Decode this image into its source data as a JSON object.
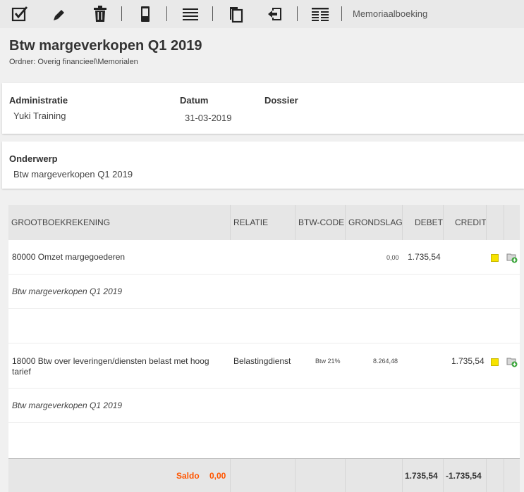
{
  "toolbar": {
    "buttons": [
      {
        "name": "approve",
        "icon": "checkbox-check-icon"
      },
      {
        "name": "edit",
        "icon": "pencil-icon"
      },
      {
        "name": "delete",
        "icon": "trash-icon"
      },
      {
        "name": "mobile",
        "icon": "phone-icon"
      },
      {
        "name": "lines",
        "icon": "lines-icon"
      },
      {
        "name": "copy",
        "icon": "copy-icon"
      },
      {
        "name": "reverse",
        "icon": "return-icon"
      },
      {
        "name": "view",
        "icon": "list-view-icon"
      }
    ],
    "label": "Memoriaalboeking"
  },
  "header": {
    "title": "Btw margeverkopen Q1 2019",
    "folder": "Ordner: Overig financieel\\Memorialen"
  },
  "details": {
    "administratie_label": "Administratie",
    "administratie_value": "Yuki Training",
    "datum_label": "Datum",
    "datum_value": "31-03-2019",
    "dossier_label": "Dossier"
  },
  "subject": {
    "label": "Onderwerp",
    "value": "Btw margeverkopen Q1 2019"
  },
  "table": {
    "columns": [
      "GROOTBOEKREKENING",
      "RELATIE",
      "BTW-CODE",
      "GRONDSLAG",
      "DEBET",
      "CREDIT"
    ],
    "rows": [
      {
        "account": "80000 Omzet margegoederen",
        "relation": "",
        "vat_code": "",
        "basis": "0,00",
        "debit": "1.735,54",
        "credit": "",
        "description": "Btw margeverkopen Q1 2019"
      },
      {
        "account": "18000 Btw over leveringen/diensten belast met hoog tarief",
        "relation": "Belastingdienst",
        "vat_code": "Btw 21%",
        "basis": "8.264,48",
        "debit": "",
        "credit": "1.735,54",
        "description": "Btw margeverkopen Q1 2019"
      }
    ],
    "footer": {
      "saldo_label": "Saldo",
      "saldo_value": "0,00",
      "debit_total": "1.735,54",
      "credit_total": "-1.735,54"
    }
  },
  "colors": {
    "accent": "#ff5500",
    "status_square": "#f7e300"
  }
}
